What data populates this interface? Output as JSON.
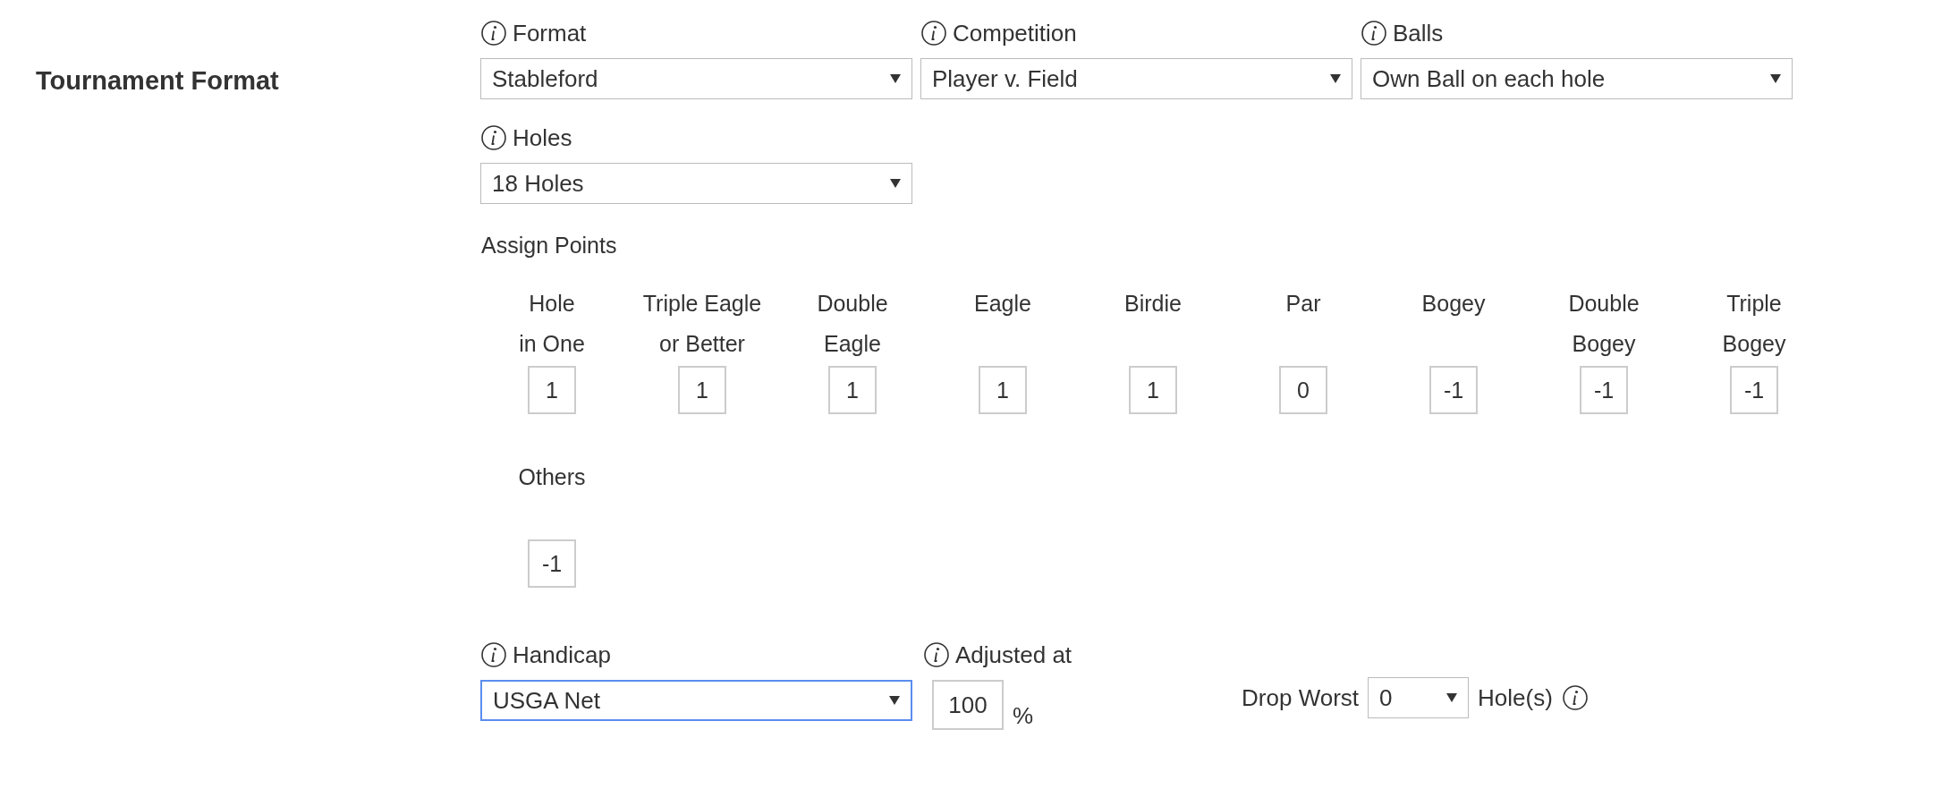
{
  "section_title": "Tournament Format",
  "field_rows": [
    {
      "fields": [
        {
          "label": "Format",
          "value": "Stableford",
          "focused": false
        },
        {
          "label": "Competition",
          "value": "Player v. Field",
          "focused": false
        },
        {
          "label": "Balls",
          "value": "Own Ball on each hole",
          "focused": false
        }
      ]
    },
    {
      "fields": [
        {
          "label": "Holes",
          "value": "18 Holes",
          "focused": false
        }
      ]
    }
  ],
  "assign_points": {
    "title": "Assign Points",
    "items": [
      {
        "label_lines": [
          "Hole",
          "in One"
        ],
        "value": "1"
      },
      {
        "label_lines": [
          "Triple Eagle",
          "or Better"
        ],
        "value": "1"
      },
      {
        "label_lines": [
          "Double",
          "Eagle"
        ],
        "value": "1"
      },
      {
        "label_lines": [
          "Eagle"
        ],
        "value": "1"
      },
      {
        "label_lines": [
          "Birdie"
        ],
        "value": "1"
      },
      {
        "label_lines": [
          "Par"
        ],
        "value": "0"
      },
      {
        "label_lines": [
          "Bogey"
        ],
        "value": "-1"
      },
      {
        "label_lines": [
          "Double",
          "Bogey"
        ],
        "value": "-1"
      },
      {
        "label_lines": [
          "Triple",
          "Bogey"
        ],
        "value": "-1"
      },
      {
        "label_lines": [
          "Others"
        ],
        "value": "-1"
      }
    ]
  },
  "handicap": {
    "label": "Handicap",
    "value": "USGA Net",
    "focused": true
  },
  "adjusted": {
    "label": "Adjusted at",
    "value": "100",
    "unit": "%"
  },
  "drop_worst": {
    "label": "Drop Worst",
    "value": "0",
    "unit": "Hole(s)"
  }
}
